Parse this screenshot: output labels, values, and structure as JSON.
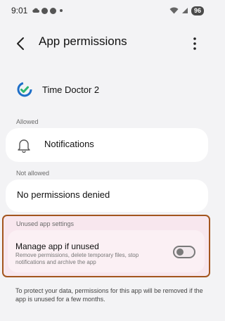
{
  "status_bar": {
    "time": "9:01",
    "battery": "96"
  },
  "header": {
    "title": "App permissions",
    "back_icon": "back-arrow-icon",
    "more_icon": "more-vert-icon"
  },
  "app": {
    "name": "Time Doctor 2",
    "icon": "time-doctor-logo"
  },
  "sections": {
    "allowed": {
      "label": "Allowed",
      "items": [
        {
          "label": "Notifications",
          "icon": "bell-icon"
        }
      ]
    },
    "not_allowed": {
      "label": "Not allowed",
      "items": [
        {
          "label": "No permissions denied"
        }
      ]
    },
    "unused": {
      "label": "Unused app settings",
      "toggle_title": "Manage app if unused",
      "toggle_desc": "Remove permissions, delete temporary files, stop notifications and archive the app",
      "toggle_on": false
    }
  },
  "footer_note": "To protect your data, permissions for this app will be removed if the app is unused for a few months.",
  "colors": {
    "highlight_border": "#a3561f",
    "background": "#f3f3f5",
    "card": "#ffffff"
  }
}
